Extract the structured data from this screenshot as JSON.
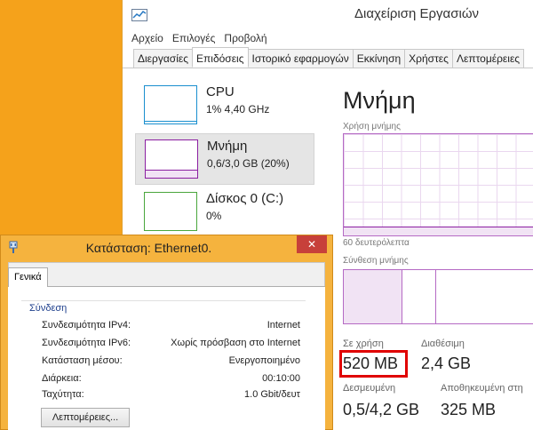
{
  "task_manager": {
    "title": "Διαχείριση Εργασιών",
    "menu": [
      "Αρχείο",
      "Επιλογές",
      "Προβολή"
    ],
    "tabs": [
      "Διεργασίες",
      "Επιδόσεις",
      "Ιστορικό εφαρμογών",
      "Εκκίνηση",
      "Χρήστες",
      "Λεπτομέρειες"
    ],
    "active_tab": "Επιδόσεις",
    "perf_items": [
      {
        "name": "CPU",
        "value": "1% 4,40 GHz",
        "color": "#1a8fcf"
      },
      {
        "name": "Μνήμη",
        "value": "0,6/3,0 GB (20%)",
        "color": "#8b1fa1"
      },
      {
        "name": "Δίσκος 0 (C:)",
        "value": "0%",
        "color": "#4aa63c"
      }
    ],
    "memory": {
      "heading": "Μνήμη",
      "usage_label": "Χρήση μνήμης",
      "time_label": "60 δευτερόλεπτα",
      "composition_label": "Σύνθεση μνήμης",
      "in_use_label": "Σε χρήση",
      "in_use_value": "520 MB",
      "available_label": "Διαθέσιμη",
      "available_value": "2,4 GB",
      "committed_label": "Δεσμευμένη",
      "committed_value": "0,5/4,2 GB",
      "cached_label": "Αποθηκευμένη στη",
      "cached_value": "325 MB"
    }
  },
  "ethernet_dialog": {
    "title": "Κατάσταση: Ethernet0.",
    "close_label": "✕",
    "tab": "Γενικά",
    "group": "Σύνδεση",
    "rows": [
      {
        "label": "Συνδεσιμότητα IPv4:",
        "value": "Internet"
      },
      {
        "label": "Συνδεσιμότητα IPv6:",
        "value": "Χωρίς πρόσβαση στο Internet"
      },
      {
        "label": "Κατάσταση μέσου:",
        "value": "Ενεργοποιημένο"
      },
      {
        "label": "Διάρκεια:",
        "value": "00:10:00"
      },
      {
        "label": "Ταχύτητα:",
        "value": "1.0 Gbit/δευτ"
      }
    ],
    "details_button": "Λεπτομέρειες..."
  }
}
